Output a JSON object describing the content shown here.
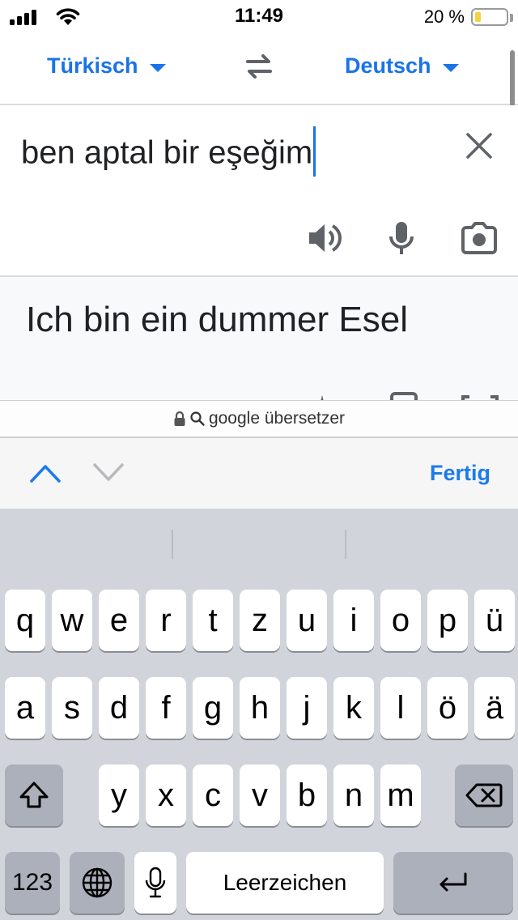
{
  "status_bar": {
    "time": "11:49",
    "battery_percent": "20 %",
    "battery_level": 0.2,
    "signal_icon": "cellular-signal-icon",
    "wifi_icon": "wifi-icon"
  },
  "translator": {
    "source_language": "Türkisch",
    "target_language": "Deutsch",
    "input_text": "ben aptal bir eşeğim",
    "translation": "Ich bin ein dummer Esel",
    "icons": [
      "swap-icon",
      "close-icon",
      "speaker-icon",
      "microphone-icon",
      "camera-icon"
    ]
  },
  "browser": {
    "url_text": "google übersetzer",
    "icons": [
      "lock-icon",
      "search-icon"
    ]
  },
  "accessory": {
    "done_label": "Fertig",
    "icons": [
      "chevron-up-icon",
      "chevron-down-icon"
    ]
  },
  "keyboard": {
    "row1": [
      "q",
      "w",
      "e",
      "r",
      "t",
      "z",
      "u",
      "i",
      "o",
      "p",
      "ü"
    ],
    "row2": [
      "a",
      "s",
      "d",
      "f",
      "g",
      "h",
      "j",
      "k",
      "l",
      "ö",
      "ä"
    ],
    "row3": [
      "y",
      "x",
      "c",
      "v",
      "b",
      "n",
      "m"
    ],
    "numbers_key": "123",
    "space_label": "Leerzeichen",
    "icons": [
      "shift-icon",
      "backspace-icon",
      "globe-icon",
      "microphone-icon",
      "return-icon"
    ]
  },
  "colors": {
    "accent": "#1a73e8",
    "keyboard_bg": "#d1d4da",
    "special_key": "#abb0ba",
    "done": "#1a7bea"
  }
}
